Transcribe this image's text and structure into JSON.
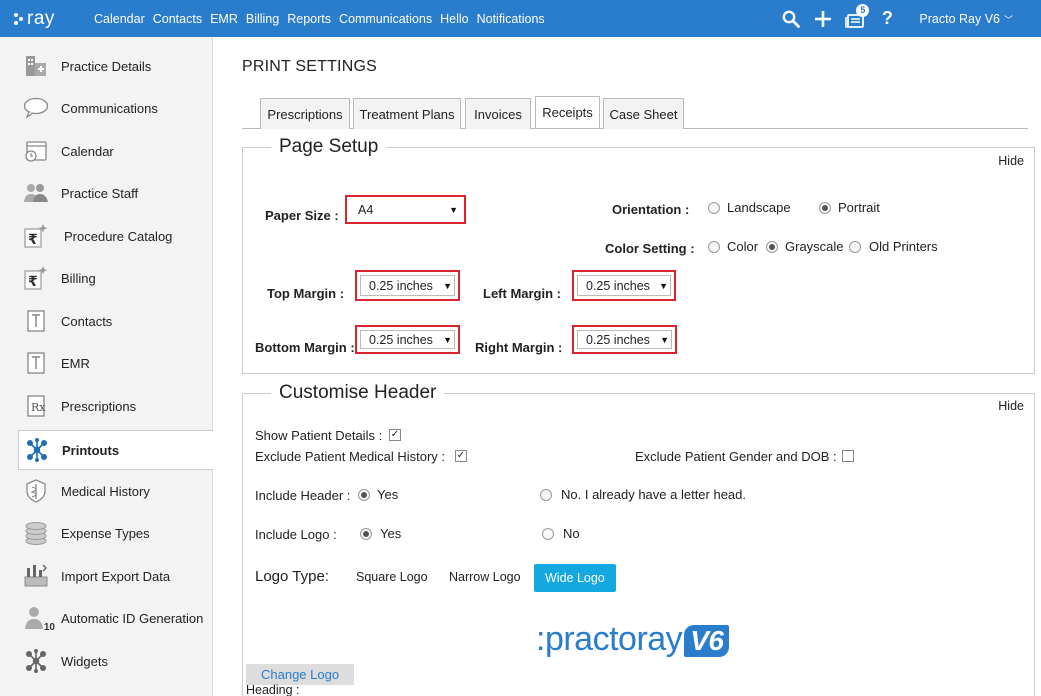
{
  "app": {
    "logo": "ray"
  },
  "nav": [
    "Calendar",
    "Contacts",
    "EMR",
    "Billing",
    "Reports",
    "Communications",
    "Hello",
    "Notifications"
  ],
  "topbar": {
    "notifications_count": "5",
    "help": "?",
    "user_name": "Practo Ray V6"
  },
  "sidebar": {
    "items": [
      {
        "label": "Practice Details",
        "icon": "building-icon"
      },
      {
        "label": "Communications",
        "icon": "speech-bubble-icon"
      },
      {
        "label": "Calendar",
        "icon": "calendar-clock-icon"
      },
      {
        "label": "Practice Staff",
        "icon": "people-icon"
      },
      {
        "label": "Procedure Catalog",
        "icon": "rupee-sparkle-icon"
      },
      {
        "label": "Billing",
        "icon": "rupee-sparkle-icon"
      },
      {
        "label": "Contacts",
        "icon": "contact-card-icon"
      },
      {
        "label": "EMR",
        "icon": "contact-card-icon"
      },
      {
        "label": "Prescriptions",
        "icon": "rx-icon"
      },
      {
        "label": "Printouts",
        "icon": "molecule-icon",
        "active": true
      },
      {
        "label": "Medical History",
        "icon": "caduceus-icon"
      },
      {
        "label": "Expense Types",
        "icon": "coins-icon"
      },
      {
        "label": "Import Export Data",
        "icon": "import-export-icon"
      },
      {
        "label": "Automatic ID Generation",
        "icon": "id-person-icon",
        "icon_badge": "10"
      },
      {
        "label": "Widgets",
        "icon": "molecule-icon"
      }
    ]
  },
  "page": {
    "title": "PRINT SETTINGS"
  },
  "tabs": [
    {
      "label": "Prescriptions"
    },
    {
      "label": "Treatment Plans"
    },
    {
      "label": "Invoices"
    },
    {
      "label": "Receipts",
      "active": true
    },
    {
      "label": "Case Sheet"
    }
  ],
  "page_setup": {
    "legend": "Page Setup",
    "hide": "Hide",
    "paper_size_label": "Paper Size :",
    "paper_size_value": "A4",
    "orientation_label": "Orientation :",
    "orientation_options": [
      "Landscape",
      "Portrait"
    ],
    "orientation_selected": "Portrait",
    "color_label": "Color Setting :",
    "color_options": [
      "Color",
      "Grayscale",
      "Old Printers"
    ],
    "color_selected": "Grayscale",
    "top_margin_label": "Top Margin :",
    "top_margin_value": "0.25 inches",
    "left_margin_label": "Left Margin :",
    "left_margin_value": "0.25 inches",
    "bottom_margin_label": "Bottom Margin :",
    "bottom_margin_value": "0.25 inches",
    "right_margin_label": "Right Margin :",
    "right_margin_value": "0.25 inches"
  },
  "header": {
    "legend": "Customise Header",
    "hide": "Hide",
    "show_patient_details": "Show Patient Details :",
    "exclude_medical_history": "Exclude Patient Medical History :",
    "exclude_gender_dob": "Exclude Patient Gender and DOB :",
    "include_header_label": "Include Header :",
    "include_header_yes": "Yes",
    "include_header_no": "No. I already have a letter head.",
    "include_logo_label": "Include Logo :",
    "include_logo_yes": "Yes",
    "include_logo_no": "No",
    "logo_type_label": "Logo Type:",
    "logo_types": [
      "Square Logo",
      "Narrow Logo",
      "Wide Logo"
    ],
    "logo_type_selected": "Wide Logo",
    "brand_text": ":practoray",
    "brand_v6": "V6",
    "change_logo": "Change Logo",
    "heading_label": "Heading :"
  }
}
